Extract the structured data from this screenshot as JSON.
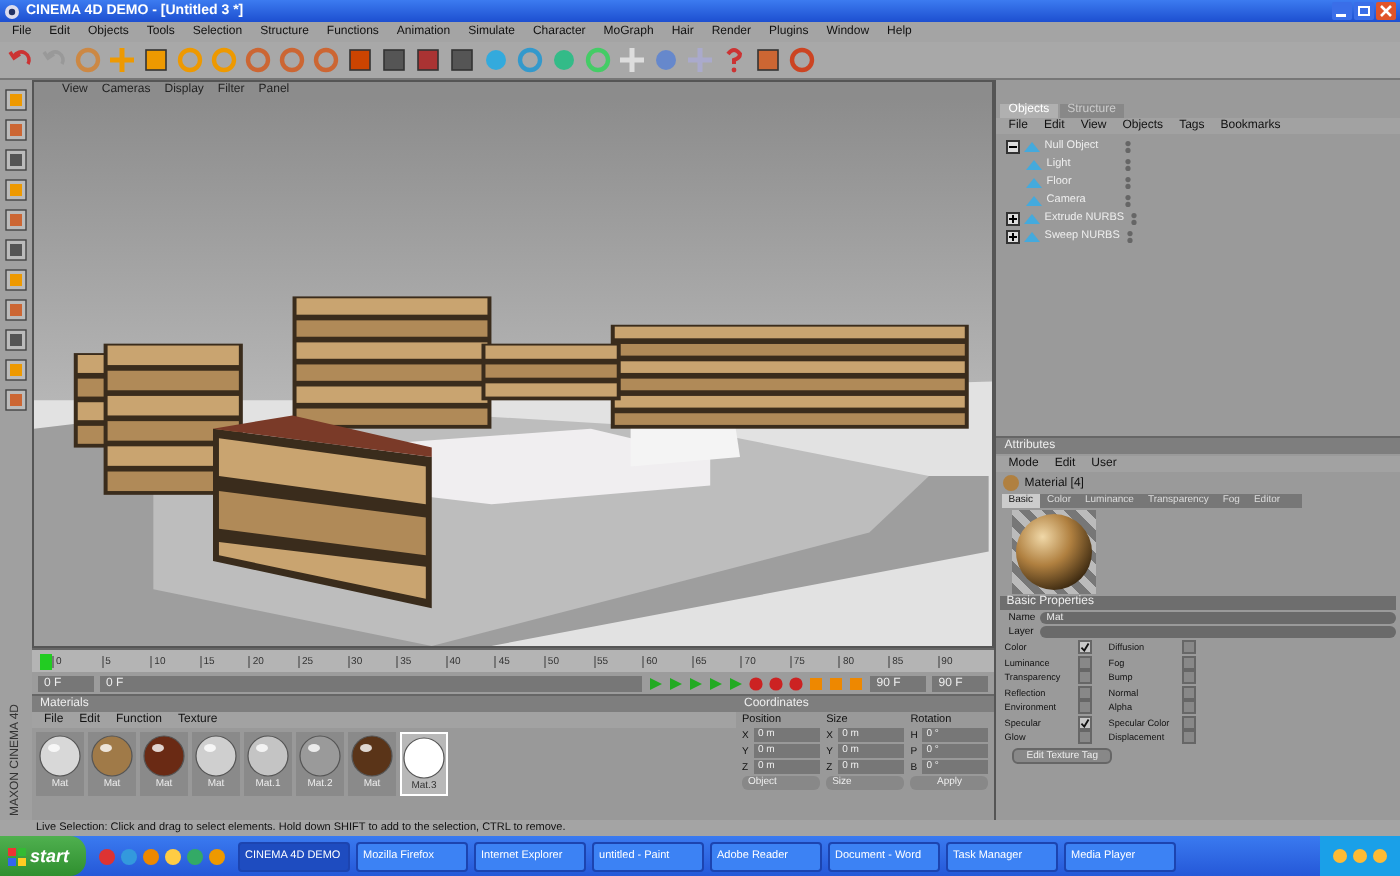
{
  "window": {
    "title": "CINEMA 4D DEMO - [Untitled 3 *]"
  },
  "menu_bar": [
    "File",
    "Edit",
    "Objects",
    "Tools",
    "Selection",
    "Structure",
    "Functions",
    "Animation",
    "Simulate",
    "Character",
    "MoGraph",
    "Hair",
    "Render",
    "Plugins",
    "Window",
    "Help"
  ],
  "viewport": {
    "menu": [
      "View",
      "Cameras",
      "Display",
      "Filter",
      "Panel"
    ]
  },
  "object_manager": {
    "tabs": [
      {
        "label": "Objects",
        "selected": true
      },
      {
        "label": "Structure",
        "selected": false
      }
    ],
    "menu": [
      "File",
      "Edit",
      "View",
      "Objects",
      "Tags",
      "Bookmarks"
    ],
    "objects": [
      {
        "name": "Null Object",
        "expanded": true,
        "children": [
          {
            "name": "Light"
          },
          {
            "name": "Floor"
          },
          {
            "name": "Camera"
          }
        ]
      },
      {
        "name": "Extrude NURBS",
        "expanded": false
      },
      {
        "name": "Sweep NURBS",
        "expanded": false
      }
    ]
  },
  "attributes": {
    "title": "Attributes",
    "menu": [
      "Mode",
      "Edit",
      "User"
    ],
    "material": "Material [4]",
    "tabs": [
      {
        "label": "Basic",
        "selected": true
      },
      {
        "label": "Color",
        "selected": false
      },
      {
        "label": "Luminance",
        "selected": false
      },
      {
        "label": "Transparency",
        "selected": false
      },
      {
        "label": "Fog",
        "selected": false
      },
      {
        "label": "Editor",
        "selected": false
      }
    ],
    "section": "Basic Properties",
    "fields": [
      {
        "label": "Name",
        "value": "Mat"
      },
      {
        "label": "Layer"
      }
    ],
    "channels": [
      {
        "label": "Color",
        "checked": true
      },
      {
        "label": "Diffusion",
        "checked": false
      },
      {
        "label": "Luminance",
        "checked": false
      },
      {
        "label": "Fog",
        "checked": false
      },
      {
        "label": "Transparency",
        "checked": false
      },
      {
        "label": "Bump",
        "checked": false
      },
      {
        "label": "Reflection",
        "checked": false
      },
      {
        "label": "Normal",
        "checked": false
      },
      {
        "label": "Environment",
        "checked": false
      },
      {
        "label": "Alpha",
        "checked": false
      },
      {
        "label": "Specular",
        "checked": true
      },
      {
        "label": "Specular Color",
        "checked": false
      },
      {
        "label": "Glow",
        "checked": false
      },
      {
        "label": "Displacement",
        "checked": false
      }
    ],
    "button": "Edit Texture Tag"
  },
  "timeline": {
    "ticks": [
      "0",
      "5",
      "10",
      "15",
      "20",
      "25",
      "30",
      "35",
      "40",
      "45",
      "50",
      "55",
      "60",
      "65",
      "70",
      "75",
      "80",
      "85",
      "90"
    ],
    "start": "0 F",
    "current": "0 F",
    "end": "90 F",
    "maximum": "90 F"
  },
  "materials": {
    "title": "Materials",
    "menu": [
      "File",
      "Edit",
      "Function",
      "Texture"
    ],
    "swatches": [
      {
        "label": "Mat",
        "color": "#d8d8d8",
        "selected": false
      },
      {
        "label": "Mat",
        "color": "#a07a48",
        "selected": false
      },
      {
        "label": "Mat",
        "color": "#6a2a14",
        "selected": false
      },
      {
        "label": "Mat",
        "color": "#cfcfcf",
        "selected": false
      },
      {
        "label": "Mat.1",
        "color": "#c4c4c4",
        "selected": false
      },
      {
        "label": "Mat.2",
        "color": "#9a9a9a",
        "selected": false
      },
      {
        "label": "Mat",
        "color": "#5a3418",
        "selected": false
      },
      {
        "label": "Mat.3",
        "color": "#ffffff",
        "selected": true
      }
    ]
  },
  "coordinates": {
    "title": "Coordinates",
    "headers": [
      "Position",
      "Size",
      "Rotation"
    ],
    "rows": [
      {
        "axis": "X",
        "position": "0 m",
        "size_axis": "X",
        "size": "0 m",
        "rotation_axis": "H",
        "rotation": "0 °"
      },
      {
        "axis": "Y",
        "position": "0 m",
        "size_axis": "Y",
        "size": "0 m",
        "rotation_axis": "P",
        "rotation": "0 °"
      },
      {
        "axis": "Z",
        "position": "0 m",
        "size_axis": "Z",
        "size": "0 m",
        "rotation_axis": "B",
        "rotation": "0 °"
      }
    ],
    "mode": "Object",
    "size_mode": "Size",
    "apply": "Apply"
  },
  "side_label": "MAXON CINEMA 4D",
  "status_bar": "Live Selection: Click and drag to select elements. Hold down SHIFT to add to the selection, CTRL to remove.",
  "taskbar": {
    "start": "start",
    "tasks": [
      {
        "label": "CINEMA 4D DEMO",
        "selected": true
      },
      {
        "label": "Mozilla Firefox",
        "selected": false
      },
      {
        "label": "Internet Explorer",
        "selected": false
      },
      {
        "label": "untitled - Paint",
        "selected": false
      },
      {
        "label": "Adobe Reader",
        "selected": false
      },
      {
        "label": "Document - Word",
        "selected": false
      },
      {
        "label": "Task Manager",
        "selected": false
      },
      {
        "label": "Media Player",
        "selected": false
      }
    ]
  }
}
